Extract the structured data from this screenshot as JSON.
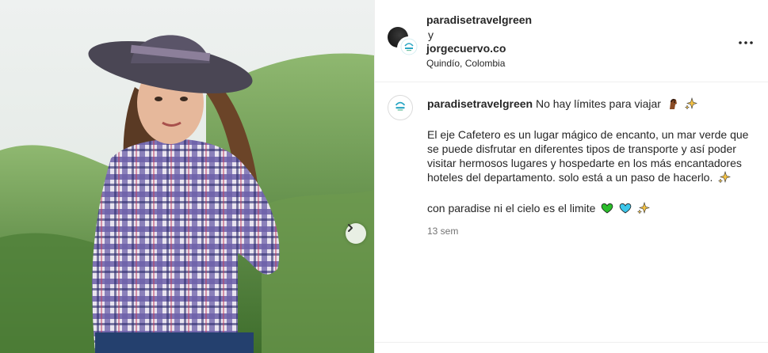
{
  "post": {
    "header": {
      "user1": "paradisetravelgreen",
      "separator": "y",
      "user2": "jorgecuervo.co",
      "location": "Quindío, Colombia"
    },
    "caption": {
      "username": "paradisetravelgreen",
      "headline": "No hay límites para viajar",
      "paragraph": "El eje Cafetero es un lugar mágico de encanto, un mar verde que se puede disfrutar en diferentes tipos de transporte y así poder visitar hermosos lugares y hospedarte en los más encantadores hoteles del departamento. solo está a un paso de hacerlo.",
      "closing": "con paradise ni el cielo es el limite",
      "time": "13 sem"
    },
    "icons": {
      "next": "chevron-right-icon",
      "more": "more-options-icon"
    },
    "colors": {
      "shirt_purple": "#6b5fa8",
      "heart_green": "#2bbd2b",
      "heart_blue": "#3cc6ea",
      "sparkle": "#f6c343"
    }
  }
}
